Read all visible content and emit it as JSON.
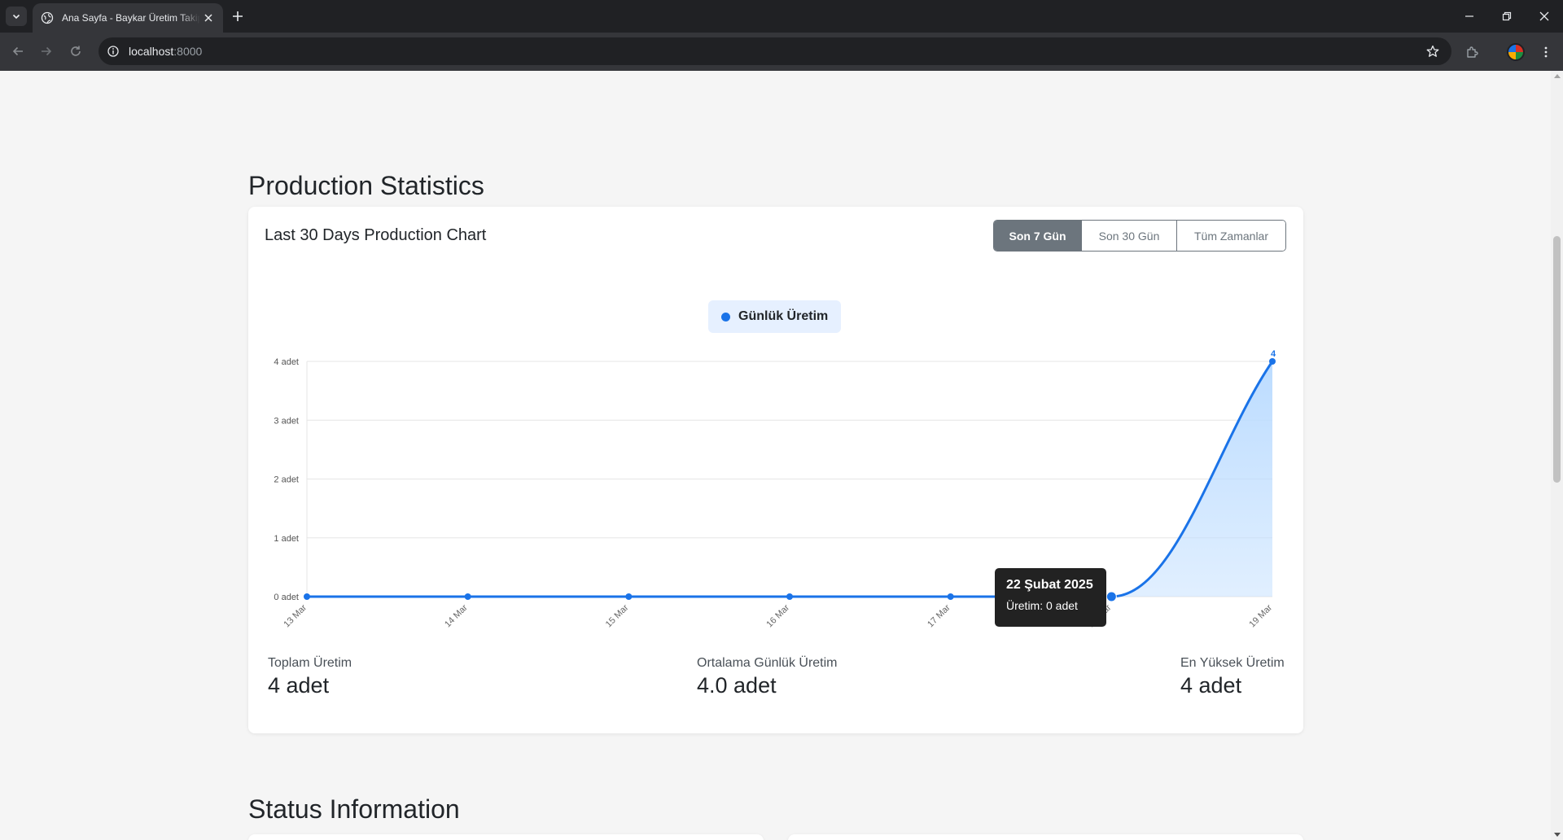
{
  "browser": {
    "tab_title": "Ana Sayfa - Baykar Üretim Takip",
    "url_host": "localhost",
    "url_port": ":8000"
  },
  "page": {
    "production_title": "Production Statistics",
    "status_title": "Status Information"
  },
  "chart_card": {
    "title": "Last 30 Days Production Chart",
    "ranges": [
      {
        "label": "Son 7 Gün",
        "active": true
      },
      {
        "label": "Son 30 Gün",
        "active": false
      },
      {
        "label": "Tüm Zamanlar",
        "active": false
      }
    ],
    "legend_label": "Günlük Üretim",
    "tooltip": {
      "title": "22 Şubat 2025",
      "body": "Üretim: 0 adet"
    }
  },
  "stats": {
    "total_label": "Toplam Üretim",
    "total_value": "4 adet",
    "avg_label": "Ortalama Günlük Üretim",
    "avg_value": "4.0 adet",
    "max_label": "En Yüksek Üretim",
    "max_value": "4 adet"
  },
  "colors": {
    "accent": "#1a73e8",
    "area_fill": "#bcdcff",
    "button_gray": "#6c757d"
  },
  "chart_data": {
    "type": "area",
    "categories": [
      "13 Mar",
      "14 Mar",
      "15 Mar",
      "16 Mar",
      "17 Mar",
      "18 Mar",
      "19 Mar"
    ],
    "series": [
      {
        "name": "Günlük Üretim",
        "values": [
          0,
          0,
          0,
          0,
          0,
          0,
          4
        ]
      }
    ],
    "y_ticks": [
      "0 adet",
      "1 adet",
      "2 adet",
      "3 adet",
      "4 adet"
    ],
    "ylim": [
      0,
      4
    ],
    "grid": true,
    "legend_position": "top-center",
    "data_labels": [
      {
        "index": 6,
        "text": "4"
      }
    ],
    "highlighted_index": 5
  }
}
